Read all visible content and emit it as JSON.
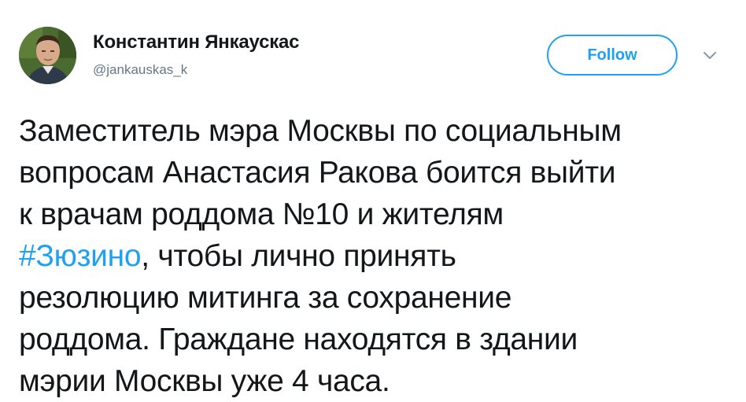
{
  "author": {
    "display_name": "Константин Янкаускас",
    "handle": "@jankauskas_k"
  },
  "follow_button": {
    "label": "Follow"
  },
  "icons": {
    "caret": "chevron-down-icon",
    "avatar": "profile-photo"
  },
  "colors": {
    "accent": "#1da1f2",
    "text": "#14171a",
    "secondary_text": "#657786"
  },
  "tweet": {
    "lines": [
      {
        "text": "Заместитель мэра Москвы по социальным"
      },
      {
        "text": "вопросам Анастасия Ракова боится выйти"
      },
      {
        "text": "к врачам роддома №10 и жителям"
      },
      {
        "hashtag": "#Зюзино",
        "text": ", чтобы лично принять"
      },
      {
        "text": "резолюцию митинга за сохранение"
      },
      {
        "text": "роддома. Граждане находятся в здании"
      },
      {
        "text": "мэрии Москвы уже 4 часа."
      }
    ]
  }
}
